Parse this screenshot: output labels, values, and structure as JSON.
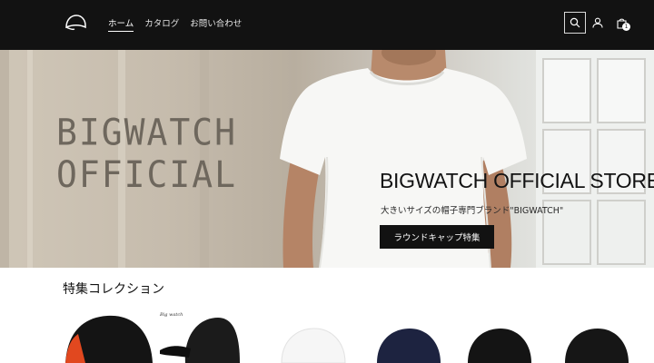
{
  "header": {
    "logo_icon": "cap-logo-icon",
    "nav": [
      {
        "label": "ホーム",
        "active": true
      },
      {
        "label": "カタログ",
        "active": false
      },
      {
        "label": "お問い合わせ",
        "active": false
      }
    ],
    "icons": [
      "search-icon",
      "account-icon",
      "cart-icon"
    ],
    "cart_count": "1"
  },
  "hero": {
    "watermark_line1": "BIGWATCH",
    "watermark_line2": "OFFICIAL",
    "title": "BIGWATCH OFFICIAL STORE",
    "subtitle": "大きいサイズの帽子専門ブランド\"BIGWATCH\"",
    "button_label": "ラウンドキャップ特集"
  },
  "featured": {
    "title": "特集コレクション",
    "items": [
      {
        "name": "product-black-orange-watch-cap"
      },
      {
        "name": "product-black-camo-cap",
        "brand_mark": "Big watch"
      },
      {
        "name": "product-white-cap"
      },
      {
        "name": "product-navy-cap"
      },
      {
        "name": "product-black-cap"
      },
      {
        "name": "product-black-cap-2"
      }
    ]
  },
  "colors": {
    "header_bg": "#121212",
    "button_bg": "#121212",
    "accent_text": "#ffffff"
  }
}
